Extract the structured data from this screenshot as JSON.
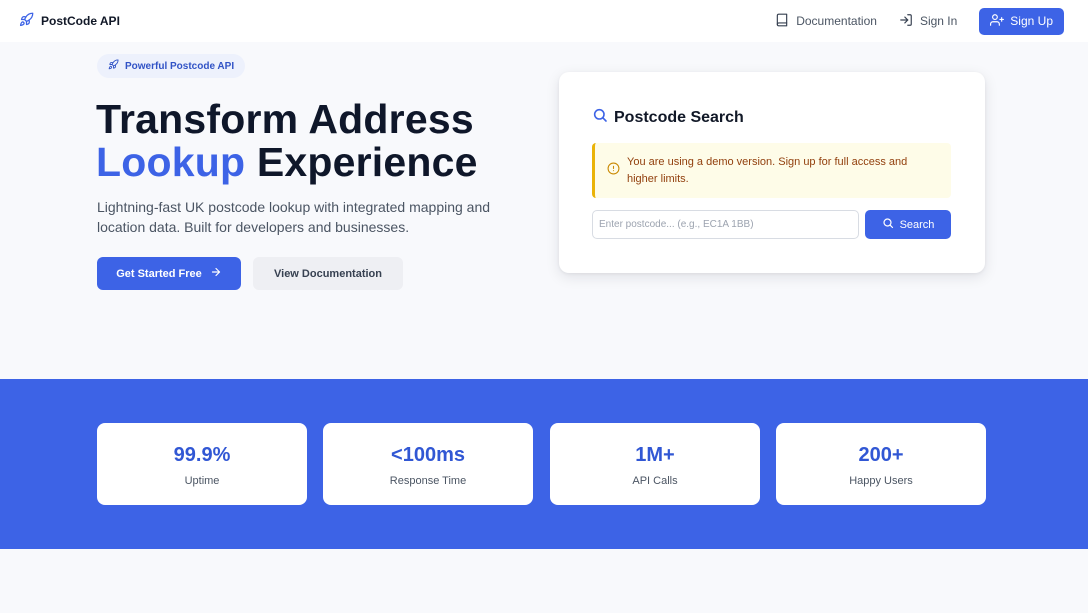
{
  "navbar": {
    "brand": "PostCode API",
    "documentation": "Documentation",
    "sign_in": "Sign In",
    "sign_up": "Sign Up"
  },
  "hero": {
    "pill": "Powerful Postcode API",
    "title_line1": "Transform Address",
    "title_accent": "Lookup",
    "title_rest": " Experience",
    "subtitle": "Lightning-fast UK postcode lookup with integrated mapping and location data. Built for developers and businesses.",
    "primary_cta": "Get Started Free",
    "secondary_cta": "View Documentation"
  },
  "search_card": {
    "title": "Postcode Search",
    "alert": "You are using a demo version. Sign up for full access and higher limits.",
    "input_value": "",
    "input_placeholder": "Enter postcode... (e.g., EC1A 1BB)",
    "button": "Search"
  },
  "stats": [
    {
      "value": "99.9%",
      "label": "Uptime"
    },
    {
      "value": "<100ms",
      "label": "Response Time"
    },
    {
      "value": "1M+",
      "label": "API Calls"
    },
    {
      "value": "200+",
      "label": "Happy Users"
    }
  ],
  "colors": {
    "accent": "#3d63e6",
    "warning_border": "#eab308",
    "warning_bg": "#fefce8",
    "warning_text": "#92400e"
  },
  "icons": {
    "brand": "rocket-icon",
    "documentation": "book-icon",
    "sign_in": "sign-in-icon",
    "sign_up": "user-plus-icon",
    "search": "search-icon",
    "alert": "alert-circle-icon",
    "cta": "arrow-right-icon"
  }
}
